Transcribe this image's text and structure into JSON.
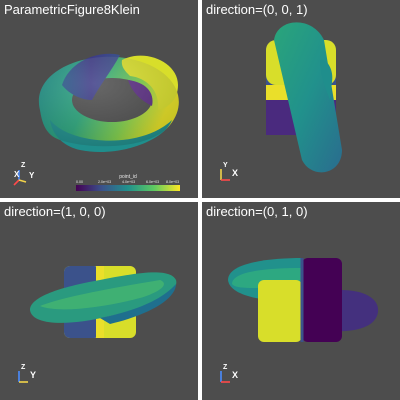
{
  "window": {
    "background": "#ffffff",
    "viewport_background": "#4d4d4d"
  },
  "viewports": [
    {
      "title": "ParametricFigure8Klein",
      "axes": {
        "labels": [
          "Z",
          "X",
          "Y"
        ],
        "colors": [
          "#4a8cff",
          "#ff4a4a",
          "#f2d34a"
        ]
      }
    },
    {
      "title": "direction=(0, 0, 1)",
      "axes": {
        "labels": [
          "Y",
          "X"
        ],
        "colors": [
          "#f2d34a",
          "#ff4a4a"
        ]
      }
    },
    {
      "title": "direction=(1, 0, 0)",
      "axes": {
        "labels": [
          "Z",
          "Y"
        ],
        "colors": [
          "#4a8cff",
          "#f2d34a"
        ]
      }
    },
    {
      "title": "direction=(0, 1, 0)",
      "axes": {
        "labels": [
          "Z",
          "X"
        ],
        "colors": [
          "#4a8cff",
          "#ff4a4a"
        ]
      }
    }
  ],
  "scalar_bar": {
    "title": "point_id",
    "ticks": [
      "0.00",
      "2.0e+03",
      "4.0e+03",
      "6.0e+03",
      "8.0e+03"
    ],
    "colormap": [
      "#440154",
      "#3b528b",
      "#21918c",
      "#5ec962",
      "#fde725"
    ]
  }
}
